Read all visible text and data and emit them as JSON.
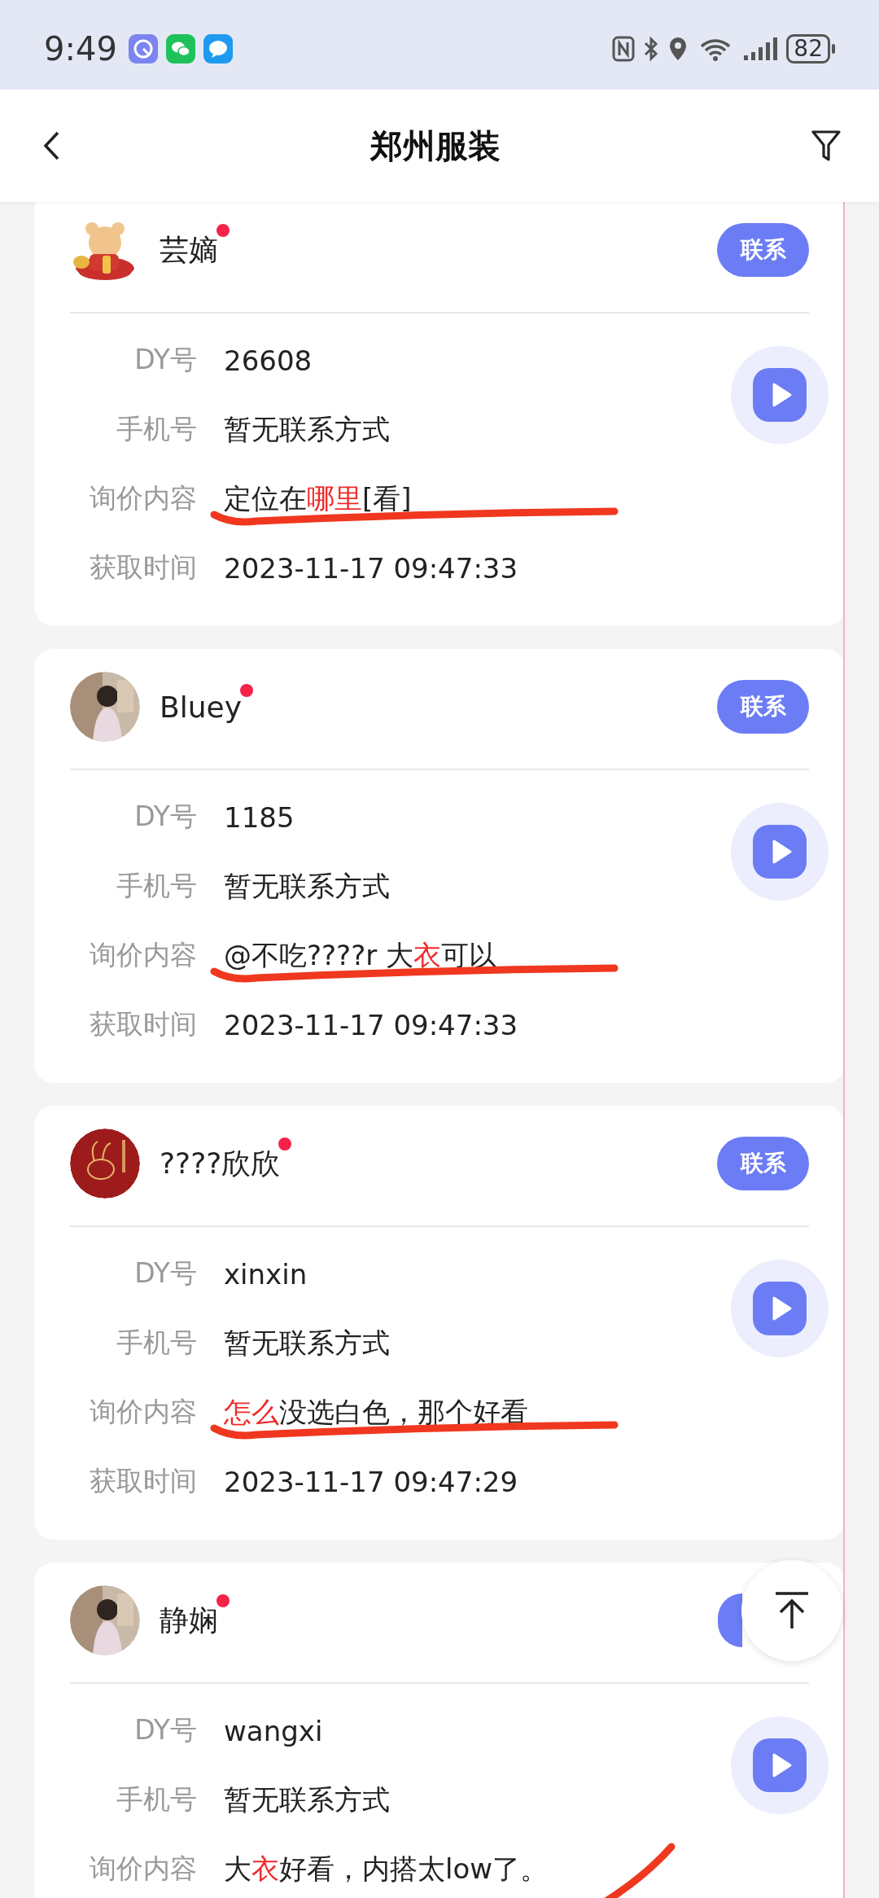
{
  "status_bar": {
    "time": "9:49",
    "battery": "82"
  },
  "header": {
    "title": "郑州服装"
  },
  "leads": [
    {
      "name": "芸嫡",
      "unread": true,
      "contact_label": "联系",
      "fields": [
        {
          "label": "DY号",
          "value": [
            {
              "text": "26608",
              "highlight": false
            }
          ]
        },
        {
          "label": "手机号",
          "value": [
            {
              "text": "暂无联系方式",
              "highlight": false
            }
          ]
        },
        {
          "label": "询价内容",
          "value": [
            {
              "text": "定位在",
              "highlight": false
            },
            {
              "text": "哪里",
              "highlight": true
            },
            {
              "text": "[看]",
              "highlight": false
            }
          ]
        },
        {
          "label": "获取时间",
          "value": [
            {
              "text": "2023-11-17 09:47:33",
              "highlight": false
            }
          ]
        }
      ]
    },
    {
      "name": "Bluey",
      "unread": true,
      "contact_label": "联系",
      "fields": [
        {
          "label": "DY号",
          "value": [
            {
              "text": "1185",
              "highlight": false
            }
          ]
        },
        {
          "label": "手机号",
          "value": [
            {
              "text": "暂无联系方式",
              "highlight": false
            }
          ]
        },
        {
          "label": "询价内容",
          "value": [
            {
              "text": "@不吃????r 大",
              "highlight": false
            },
            {
              "text": "衣",
              "highlight": true
            },
            {
              "text": "可以",
              "highlight": false
            }
          ]
        },
        {
          "label": "获取时间",
          "value": [
            {
              "text": "2023-11-17 09:47:33",
              "highlight": false
            }
          ]
        }
      ]
    },
    {
      "name": "????欣欣",
      "unread": true,
      "contact_label": "联系",
      "fields": [
        {
          "label": "DY号",
          "value": [
            {
              "text": "xinxin",
              "highlight": false
            }
          ]
        },
        {
          "label": "手机号",
          "value": [
            {
              "text": "暂无联系方式",
              "highlight": false
            }
          ]
        },
        {
          "label": "询价内容",
          "value": [
            {
              "text": "怎么",
              "highlight": true
            },
            {
              "text": "没选白色，那个好看",
              "highlight": false
            }
          ]
        },
        {
          "label": "获取时间",
          "value": [
            {
              "text": "2023-11-17 09:47:29",
              "highlight": false
            }
          ]
        }
      ]
    },
    {
      "name": "静娴",
      "unread": true,
      "fields": [
        {
          "label": "DY号",
          "value": [
            {
              "text": "wangxi",
              "highlight": false
            }
          ]
        },
        {
          "label": "手机号",
          "value": [
            {
              "text": "暂无联系方式",
              "highlight": false
            }
          ]
        },
        {
          "label": "询价内容",
          "value": [
            {
              "text": "大",
              "highlight": false
            },
            {
              "text": "衣",
              "highlight": true
            },
            {
              "text": "好看，内搭太low了。",
              "highlight": false
            }
          ]
        }
      ]
    }
  ]
}
